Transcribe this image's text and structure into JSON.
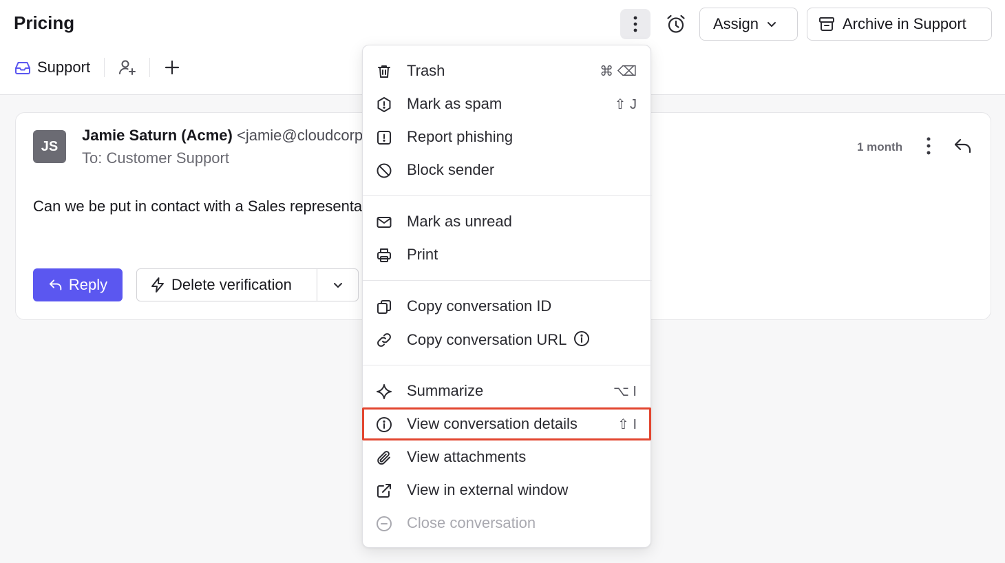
{
  "header": {
    "title": "Pricing",
    "assign_label": "Assign",
    "archive_label": "Archive in Support"
  },
  "tabs": {
    "support_label": "Support"
  },
  "message": {
    "avatar_initials": "JS",
    "sender_name": "Jamie Saturn (Acme)",
    "sender_email": "<jamie@cloudcorp.com>",
    "to": "To: Customer Support",
    "time": "1 month",
    "body": "Can we be put in contact with a Sales representative?",
    "reply_label": "Reply",
    "macro_label": "Delete verification"
  },
  "menu": {
    "items": [
      {
        "label": "Trash",
        "shortcut": "⌘ ⌫",
        "icon": "trash-icon"
      },
      {
        "label": "Mark as spam",
        "shortcut": "⇧ J",
        "icon": "spam-icon"
      },
      {
        "label": "Report phishing",
        "shortcut": "",
        "icon": "phishing-icon"
      },
      {
        "label": "Block sender",
        "shortcut": "",
        "icon": "block-icon"
      },
      {
        "label": "Mark as unread",
        "shortcut": "",
        "icon": "envelope-icon"
      },
      {
        "label": "Print",
        "shortcut": "",
        "icon": "printer-icon"
      },
      {
        "label": "Copy conversation ID",
        "shortcut": "",
        "icon": "copy-icon"
      },
      {
        "label": "Copy conversation URL",
        "shortcut": "",
        "icon": "link-icon"
      },
      {
        "label": "Summarize",
        "shortcut": "⌥ I",
        "icon": "sparkle-icon"
      },
      {
        "label": "View conversation details",
        "shortcut": "⇧ I",
        "icon": "info-icon"
      },
      {
        "label": "View attachments",
        "shortcut": "",
        "icon": "paperclip-icon"
      },
      {
        "label": "View in external window",
        "shortcut": "",
        "icon": "external-link-icon"
      },
      {
        "label": "Close conversation",
        "shortcut": "",
        "icon": "minus-circle-icon",
        "disabled": true
      }
    ]
  },
  "colors": {
    "accent": "#5b57f0",
    "highlight": "#e2452f"
  }
}
